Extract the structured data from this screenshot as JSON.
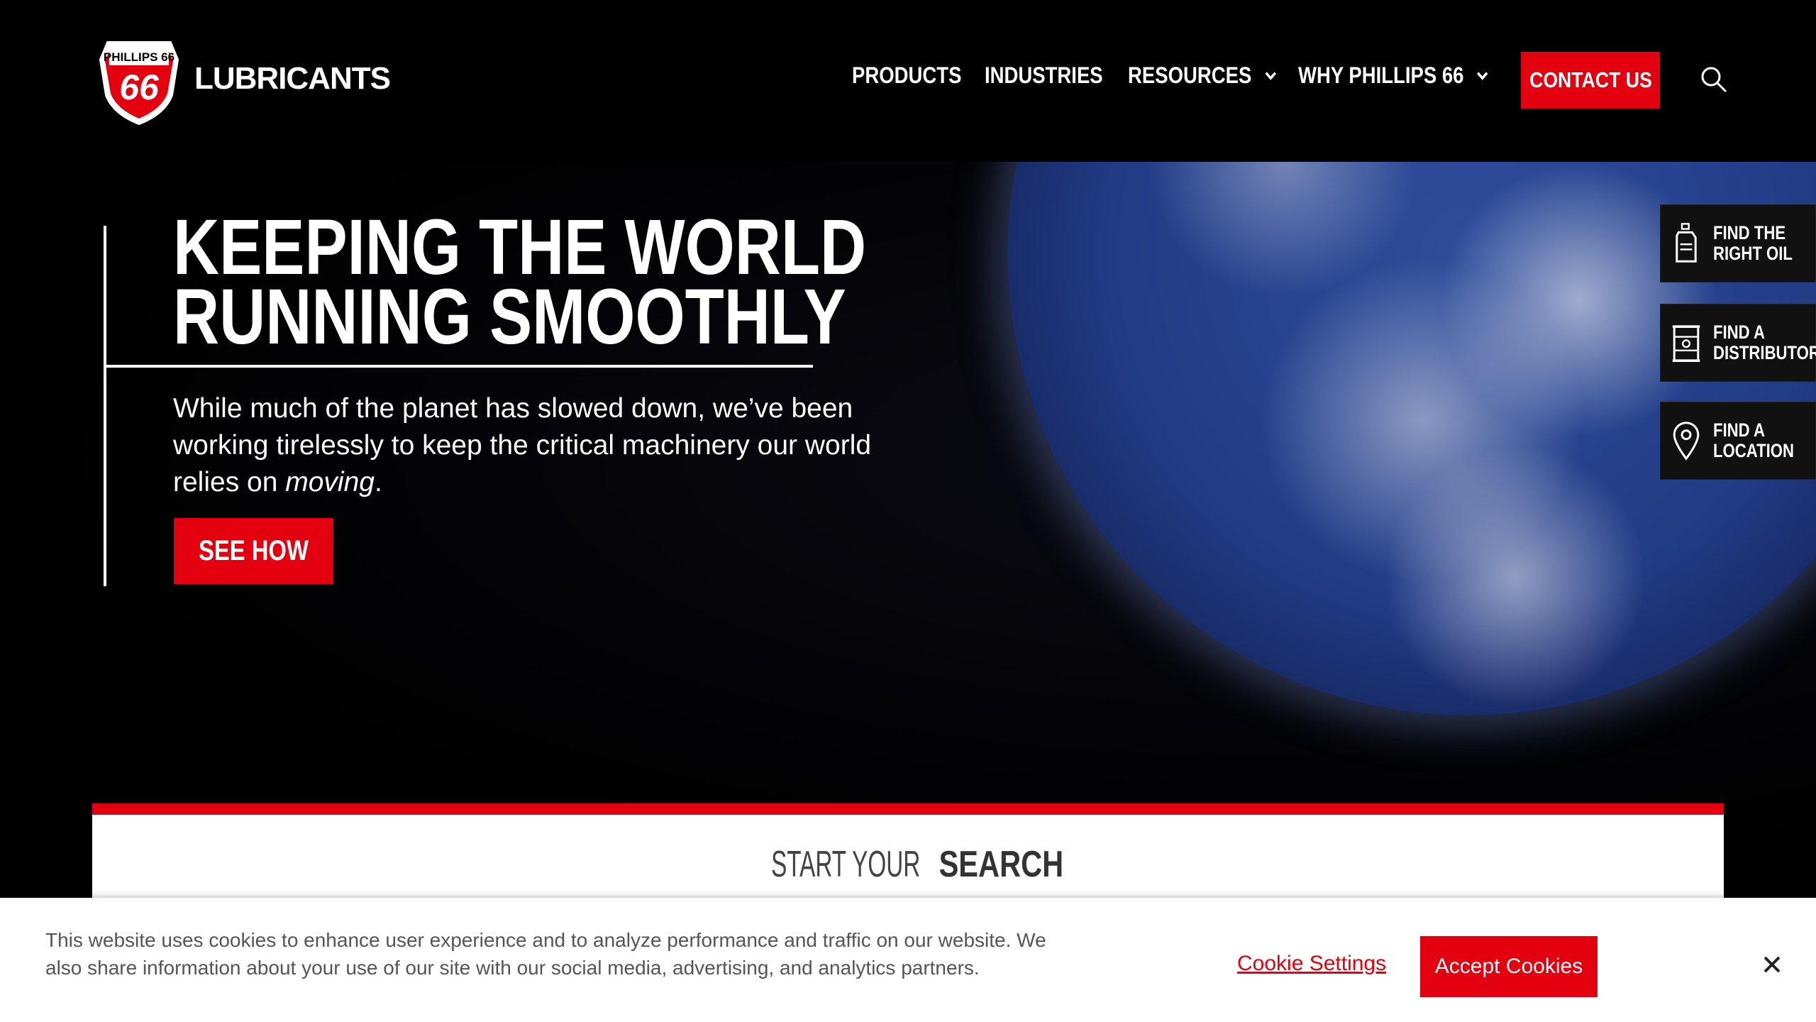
{
  "header": {
    "logo_text": "PHILLIPS 66",
    "brand": "LUBRICANTS",
    "nav": {
      "products": "PRODUCTS",
      "industries": "INDUSTRIES",
      "resources": "RESOURCES",
      "why": "WHY PHILLIPS 66"
    },
    "contact": "CONTACT US"
  },
  "hero": {
    "headline_1": "KEEPING THE WORLD",
    "headline_2": "RUNNING SMOOTHLY",
    "subtext_main": "While much of the planet has slowed down, we’ve been working tirelessly to keep the critical machinery our world relies on ",
    "subtext_em": "moving",
    "subtext_end": ".",
    "cta": "SEE HOW"
  },
  "side_tabs": {
    "oil_1": "FIND THE",
    "oil_2": "RIGHT OIL",
    "dist_1": "FIND A",
    "dist_2": "DISTRIBUTOR",
    "loc_1": "FIND A",
    "loc_2": "LOCATION"
  },
  "search": {
    "title_light": "START YOUR ",
    "title_bold": "SEARCH"
  },
  "cookie": {
    "text": "This website uses cookies to enhance user experience and to analyze performance and traffic on our website. We also share information about your use of our site with our social media, advertising, and analytics partners.",
    "settings": "Cookie Settings",
    "accept": "Accept Cookies"
  },
  "colors": {
    "accent": "#e3000f",
    "background": "#000000"
  }
}
